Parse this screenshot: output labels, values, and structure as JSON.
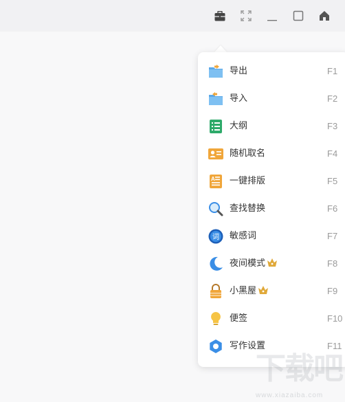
{
  "toolbar": {
    "icons": [
      "toolbox-icon",
      "fullscreen-icon",
      "minimize-icon",
      "maximize-icon",
      "home-icon"
    ]
  },
  "menu": {
    "items": [
      {
        "label": "导出",
        "key": "F1",
        "icon": "export-folder-icon",
        "crown": false
      },
      {
        "label": "导入",
        "key": "F2",
        "icon": "import-folder-icon",
        "crown": false
      },
      {
        "label": "大纲",
        "key": "F3",
        "icon": "outline-icon",
        "crown": false
      },
      {
        "label": "随机取名",
        "key": "F4",
        "icon": "name-card-icon",
        "crown": false
      },
      {
        "label": "一键排版",
        "key": "F5",
        "icon": "layout-icon",
        "crown": false
      },
      {
        "label": "查找替换",
        "key": "F6",
        "icon": "search-icon",
        "crown": false
      },
      {
        "label": "敏感词",
        "key": "F7",
        "icon": "sensitive-word-icon",
        "crown": false
      },
      {
        "label": "夜间模式",
        "key": "F8",
        "icon": "moon-icon",
        "crown": true
      },
      {
        "label": "小黑屋",
        "key": "F9",
        "icon": "lock-icon",
        "crown": true
      },
      {
        "label": "便签",
        "key": "F10",
        "icon": "lightbulb-icon",
        "crown": false
      },
      {
        "label": "写作设置",
        "key": "F11",
        "icon": "settings-icon",
        "crown": false
      }
    ]
  },
  "colors": {
    "accent_blue": "#3a8ee6",
    "crown_gold": "#e0a93a"
  },
  "watermark": {
    "text": "下载吧",
    "sub": "www.xiazaiba.com"
  }
}
